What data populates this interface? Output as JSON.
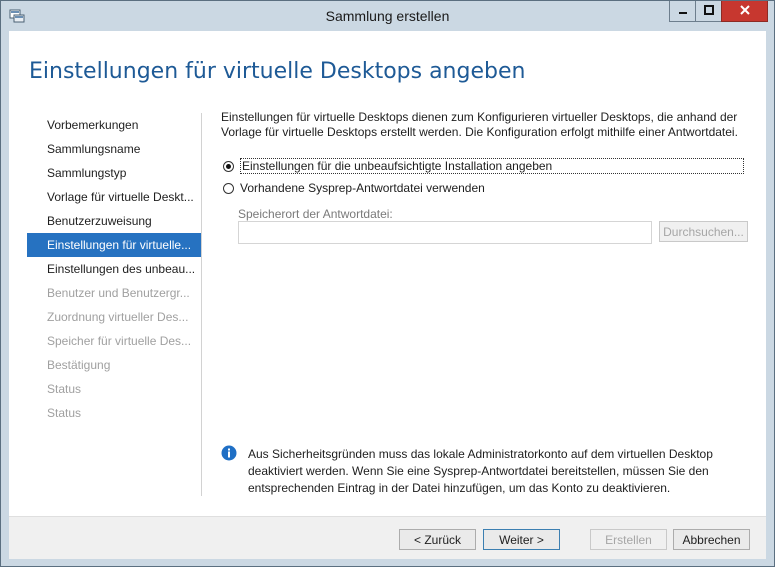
{
  "window": {
    "title": "Sammlung erstellen"
  },
  "page": {
    "title": "Einstellungen für virtuelle Desktops angeben"
  },
  "nav": {
    "items": [
      {
        "label": "Vorbemerkungen",
        "state": "normal"
      },
      {
        "label": "Sammlungsname",
        "state": "normal"
      },
      {
        "label": "Sammlungstyp",
        "state": "normal"
      },
      {
        "label": "Vorlage für virtuelle Deskt...",
        "state": "normal"
      },
      {
        "label": "Benutzerzuweisung",
        "state": "normal"
      },
      {
        "label": "Einstellungen für virtuelle...",
        "state": "selected"
      },
      {
        "label": "Einstellungen des unbeau...",
        "state": "normal"
      },
      {
        "label": "Benutzer und Benutzergr...",
        "state": "disabled"
      },
      {
        "label": "Zuordnung virtueller Des...",
        "state": "disabled"
      },
      {
        "label": "Speicher für virtuelle Des...",
        "state": "disabled"
      },
      {
        "label": "Bestätigung",
        "state": "disabled"
      },
      {
        "label": "Status",
        "state": "disabled"
      },
      {
        "label": "Status",
        "state": "disabled"
      }
    ]
  },
  "main": {
    "description": "Einstellungen für virtuelle Desktops dienen zum Konfigurieren virtueller Desktops, die anhand der Vorlage für virtuelle Desktops erstellt werden. Die Konfiguration erfolgt mithilfe einer Antwortdatei.",
    "option_unattended": {
      "label": "Einstellungen für die unbeaufsichtigte Installation angeben",
      "checked": true
    },
    "option_sysprep": {
      "label": "Vorhandene Sysprep-Antwortdatei verwenden",
      "checked": false
    },
    "answer_file_label": "Speicherort der Antwortdatei:",
    "answer_file_value": "",
    "browse_label": "Durchsuchen...",
    "info_text": "Aus Sicherheitsgründen muss das lokale Administratorkonto auf dem virtuellen Desktop deaktiviert werden. Wenn Sie eine Sysprep-Antwortdatei bereitstellen, müssen Sie den entsprechenden Eintrag in der Datei hinzufügen, um das Konto zu deaktivieren."
  },
  "footer": {
    "back_label": "< Zurück",
    "next_label": "Weiter >",
    "create_label": "Erstellen",
    "cancel_label": "Abbrechen"
  },
  "colors": {
    "accent": "#2672c1",
    "title": "#1e5a96",
    "close": "#c7372f",
    "chrome": "#cbd8e3"
  },
  "icons": {
    "app": "wizard-app-icon",
    "info": "info-icon",
    "minimize": "minimize-icon",
    "maximize": "maximize-icon",
    "close": "close-icon"
  }
}
